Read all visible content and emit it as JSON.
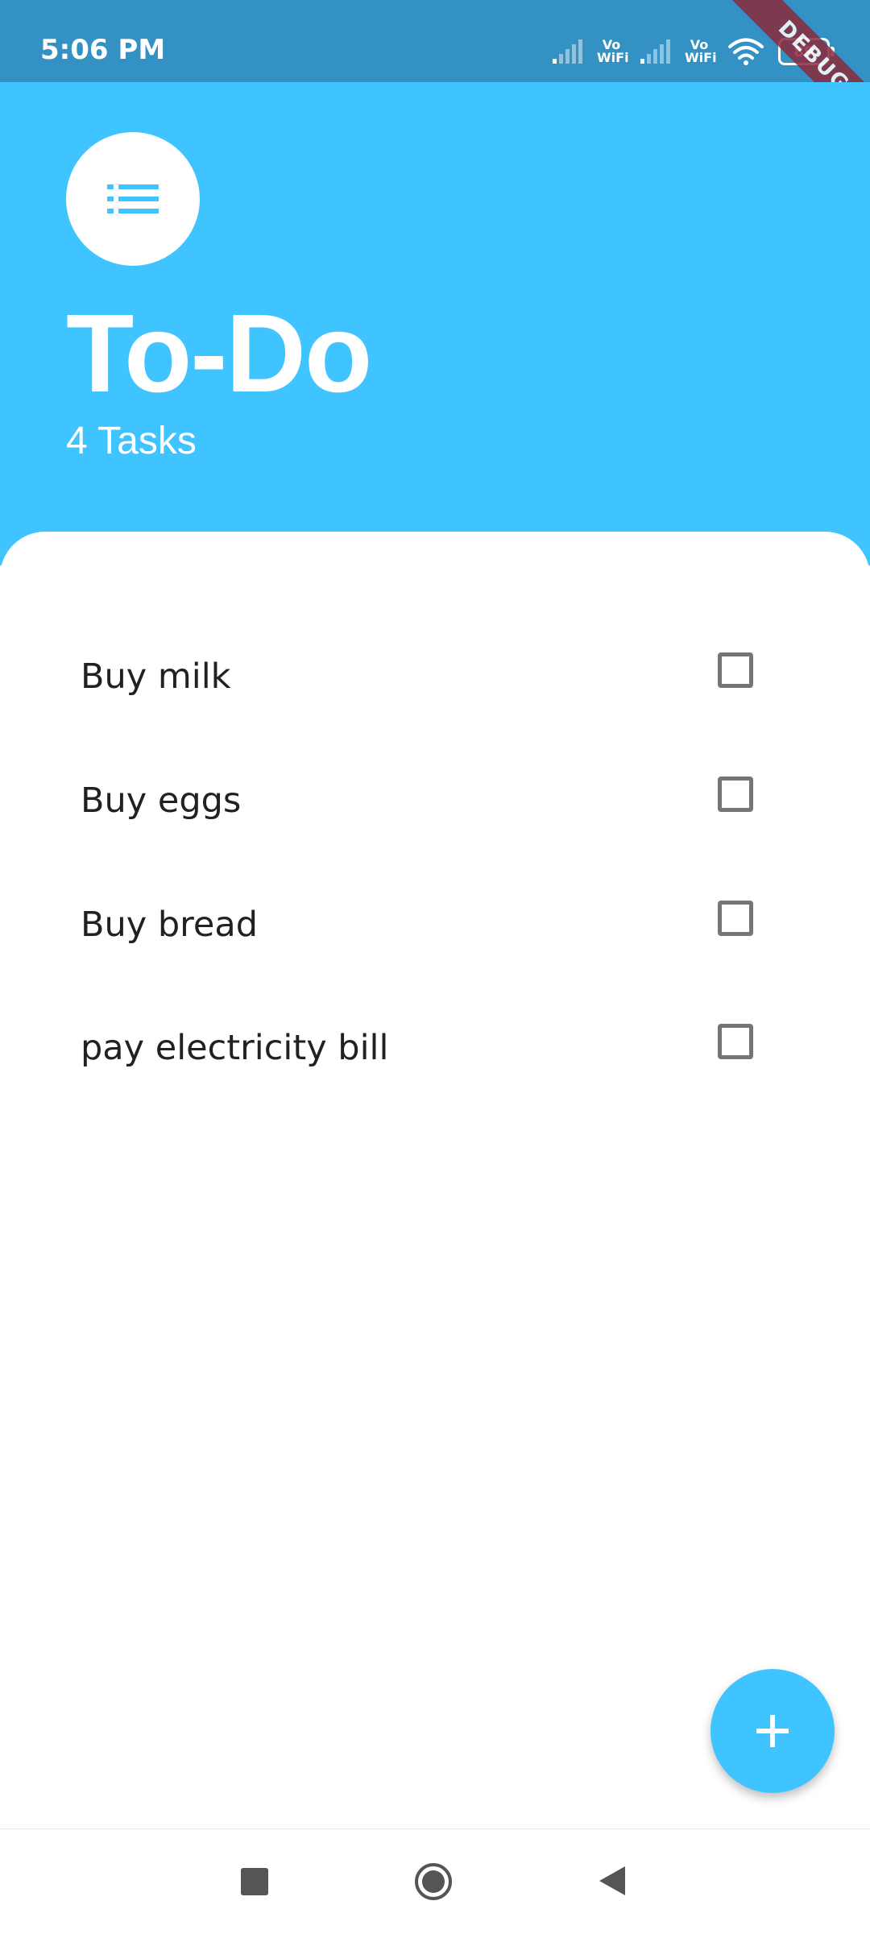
{
  "status_bar": {
    "time": "5:06 PM",
    "network_1_label": "Vo WiFi",
    "network_2_label": "Vo WiFi",
    "battery": "89",
    "icons": [
      "signal-icon",
      "vowifi-icon",
      "signal-icon",
      "vowifi-icon",
      "wifi-icon",
      "battery-icon"
    ]
  },
  "debug_banner": "DEBUG",
  "header": {
    "icon": "list-icon",
    "title": "To-Do",
    "task_count": "4 Tasks"
  },
  "tasks": [
    {
      "label": "Buy milk",
      "checked": false
    },
    {
      "label": "Buy eggs",
      "checked": false
    },
    {
      "label": "Buy bread",
      "checked": false
    },
    {
      "label": "pay electricity bill",
      "checked": false
    }
  ],
  "fab": {
    "icon": "plus-icon"
  },
  "nav_bar": {
    "icons": [
      "recent-apps-icon",
      "home-icon",
      "back-icon"
    ]
  },
  "colors": {
    "status_bar": "#3392C3",
    "accent": "#40C4FF",
    "text": "#212121",
    "checkbox_border": "#757575",
    "debug_ribbon": "#8B2A3D"
  }
}
